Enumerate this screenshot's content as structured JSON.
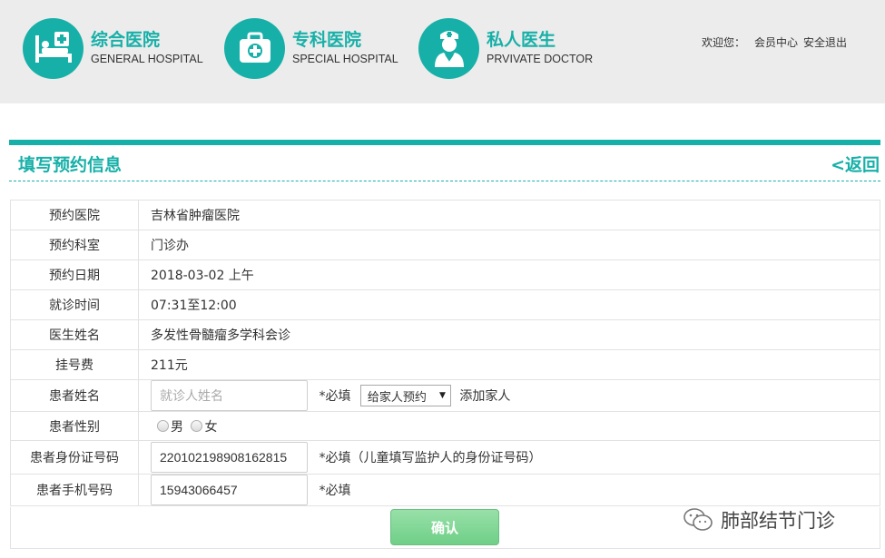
{
  "header": {
    "nav": [
      {
        "cn": "综合医院",
        "en": "GENERAL HOSPITAL",
        "icon": "hospital-bed-icon"
      },
      {
        "cn": "专科医院",
        "en": "SPECIAL HOSPITAL",
        "icon": "medical-kit-icon"
      },
      {
        "cn": "私人医生",
        "en": "PRVIVATE DOCTOR",
        "icon": "doctor-icon"
      }
    ],
    "welcome": "欢迎您：",
    "member_center": "会员中心",
    "logout": "安全退出"
  },
  "section": {
    "title": "填写预约信息",
    "back": "<返回"
  },
  "form": {
    "hospital": {
      "label": "预约医院",
      "value": "吉林省肿瘤医院"
    },
    "department": {
      "label": "预约科室",
      "value": "门诊办"
    },
    "date": {
      "label": "预约日期",
      "value": "2018-03-02 上午"
    },
    "time": {
      "label": "就诊时间",
      "value": "07:31至12:00"
    },
    "doctor": {
      "label": "医生姓名",
      "value": "多发性骨髓瘤多学科会诊"
    },
    "fee": {
      "label": "挂号费",
      "value": "211元"
    },
    "patient_name": {
      "label": "患者姓名",
      "placeholder": "就诊人姓名",
      "value": "",
      "required": "*必填",
      "select_value": "给家人预约",
      "add_family": "添加家人"
    },
    "gender": {
      "label": "患者性别",
      "options": [
        "男",
        "女"
      ]
    },
    "id_number": {
      "label": "患者身份证号码",
      "value": "220102198908162815",
      "note": "*必填（儿童填写监护人的身份证号码）"
    },
    "phone": {
      "label": "患者手机号码",
      "value": "15943066457",
      "required": "*必填"
    }
  },
  "confirm_label": "确认",
  "watermark": "肺部结节门诊",
  "colors": {
    "accent": "#17b0a8",
    "button": "#78d490"
  }
}
